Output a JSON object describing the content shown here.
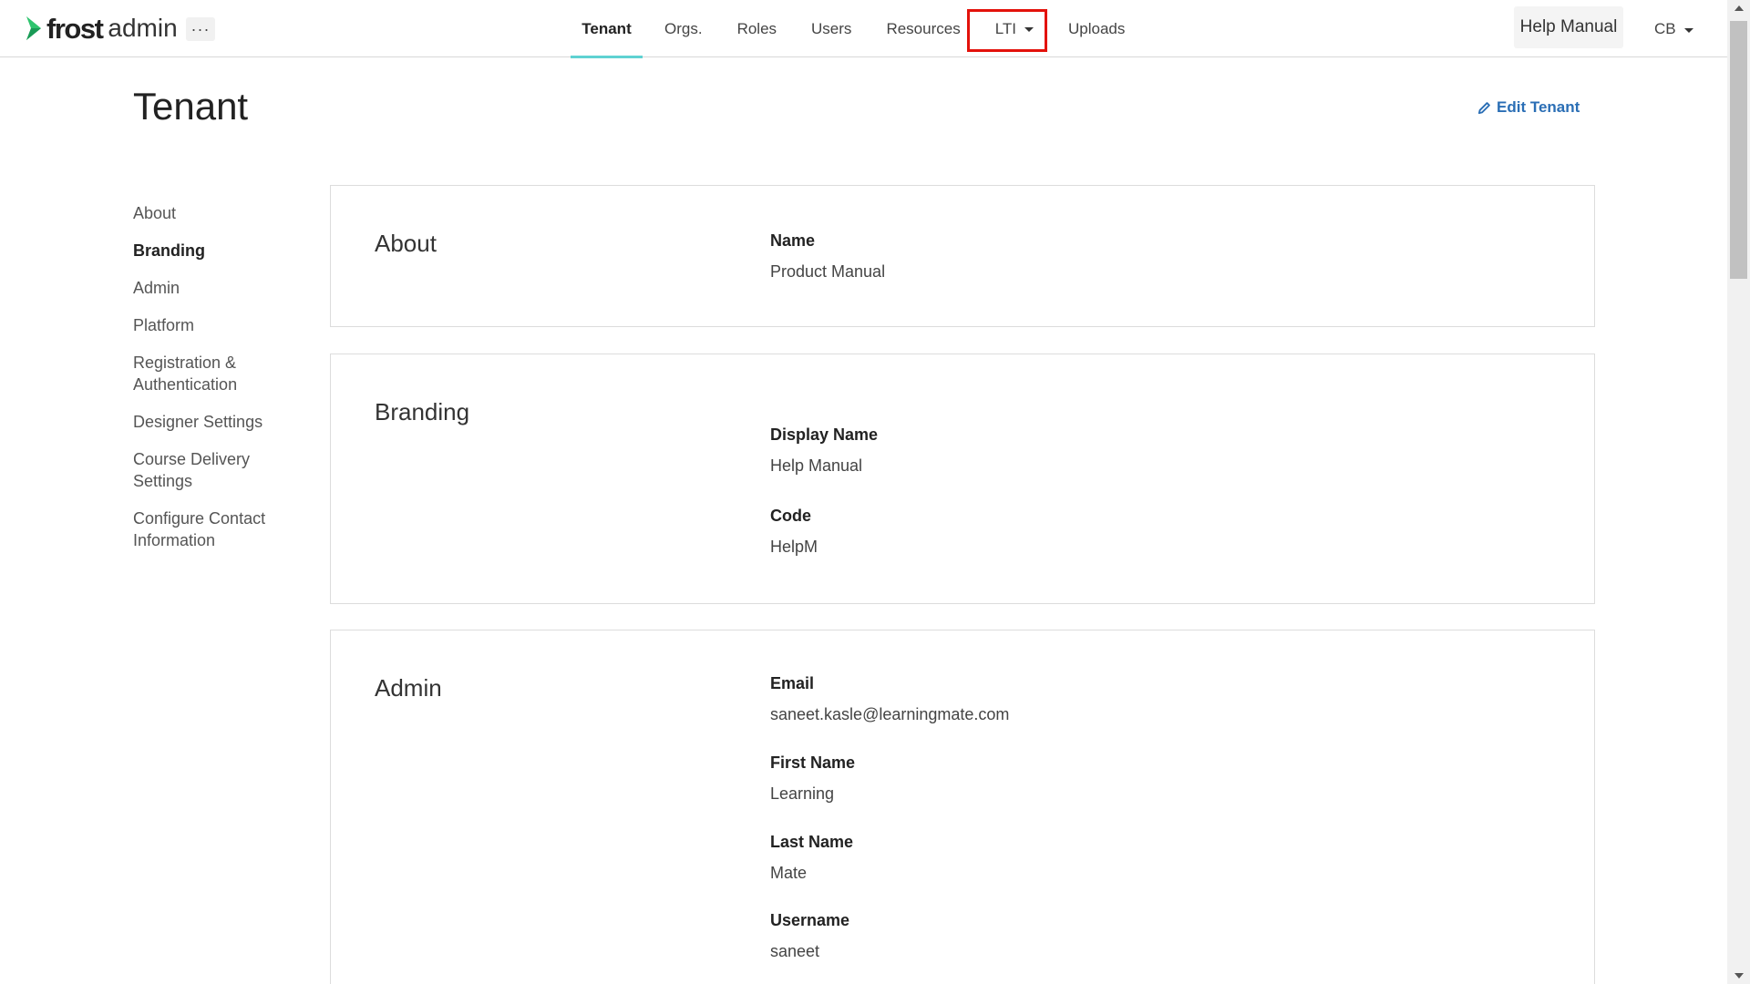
{
  "app": {
    "logo_frost": "frost",
    "logo_admin": "admin",
    "more_label": "···"
  },
  "nav": {
    "tenant": "Tenant",
    "orgs": "Orgs.",
    "roles": "Roles",
    "users": "Users",
    "resources": "Resources",
    "lti": "LTI",
    "uploads": "Uploads"
  },
  "header_right": {
    "help": "Help Manual",
    "user_initials": "CB"
  },
  "page": {
    "title": "Tenant",
    "edit_label": "Edit Tenant"
  },
  "sidemenu": {
    "items": [
      "About",
      "Branding",
      "Admin",
      "Platform",
      "Registration & Authentication",
      "Designer Settings",
      "Course Delivery Settings",
      "Configure Contact Information"
    ]
  },
  "about": {
    "title": "About",
    "name_label": "Name",
    "name_value": "Product Manual"
  },
  "branding": {
    "title": "Branding",
    "display_name_label": "Display Name",
    "display_name_value": "Help Manual",
    "code_label": "Code",
    "code_value": "HelpM"
  },
  "admin": {
    "title": "Admin",
    "email_label": "Email",
    "email_value": "saneet.kasle@learningmate.com",
    "first_name_label": "First Name",
    "first_name_value": "Learning",
    "last_name_label": "Last Name",
    "last_name_value": "Mate",
    "username_label": "Username",
    "username_value": "saneet"
  },
  "colors": {
    "accent_teal": "#5fd2d2",
    "link_blue": "#2a6eb5",
    "logo_green": "#2fc46e",
    "highlight_red": "#e3120b"
  }
}
